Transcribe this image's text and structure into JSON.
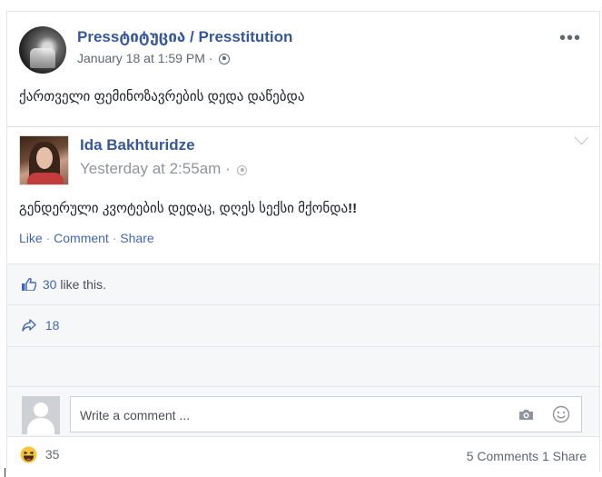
{
  "post": {
    "page_name": "Pressტიტუცია / Presstitution",
    "date": "January 18 at 1:59 PM",
    "meta_separator": "·",
    "text": "ქართველი ფემინოზავრების დედა დაწებდა"
  },
  "shared_post": {
    "author": "Ida Bakhturidze",
    "time": "Yesterday at 2:55am",
    "meta_separator": "·",
    "text": "გენდერული კვოტების დედაც, დღეს სექსი მქონდა",
    "text_emphasis": "!!",
    "actions": {
      "like": "Like",
      "comment": "Comment",
      "share": "Share",
      "separator": "·"
    }
  },
  "likes": {
    "count": "30",
    "suffix": "like this."
  },
  "shares": {
    "count": "18"
  },
  "comment": {
    "placeholder": "Write a comment ..."
  },
  "footer": {
    "reaction_count": "35",
    "comments": "5 Comments",
    "shares": "1 Share"
  },
  "colors": {
    "link": "#365899",
    "action_link": "#4267b2",
    "meta": "#606770",
    "row_bg": "#f6f7f9"
  },
  "icons": {
    "more": "more-options-icon",
    "privacy": "globe-icon",
    "chevron": "chevron-down-icon",
    "like": "thumbs-up-icon",
    "share": "share-arrow-icon",
    "camera": "camera-icon",
    "emoji": "emoji-icon",
    "reaction": "haha-icon"
  }
}
